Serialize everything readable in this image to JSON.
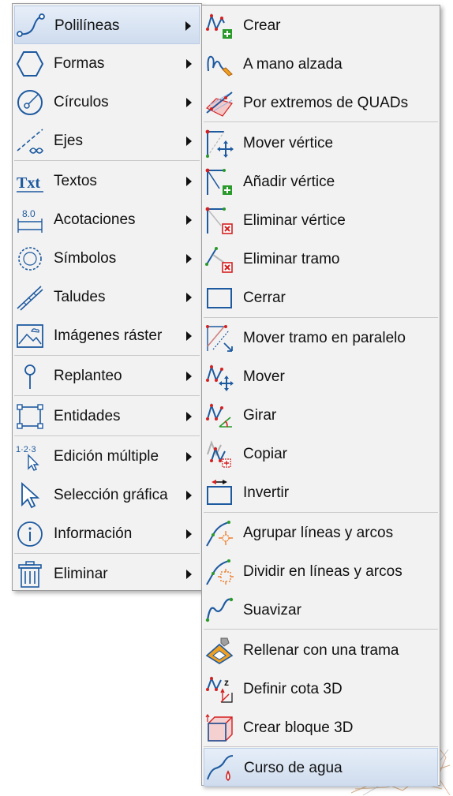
{
  "left_menu": {
    "items": [
      {
        "label": "Polilíneas",
        "icon": "polyline-icon",
        "selected": true
      },
      {
        "label": "Formas",
        "icon": "hexagon-icon"
      },
      {
        "label": "Círculos",
        "icon": "circle-icon"
      },
      {
        "label": "Ejes",
        "icon": "axis-infinity-icon"
      },
      {
        "label": "Textos",
        "icon": "text-txt-icon",
        "icon_text": "Txt"
      },
      {
        "label": "Acotaciones",
        "icon": "dimension-icon",
        "icon_text": "8.0"
      },
      {
        "label": "Símbolos",
        "icon": "symbol-icon"
      },
      {
        "label": "Taludes",
        "icon": "slope-icon"
      },
      {
        "label": "Imágenes ráster",
        "icon": "raster-image-icon"
      },
      {
        "label": "Replanteo",
        "icon": "stakeout-pin-icon"
      },
      {
        "label": "Entidades",
        "icon": "entities-icon"
      },
      {
        "label": "Edición múltiple",
        "icon": "multi-edit-icon",
        "icon_text": "1·2·3"
      },
      {
        "label": "Selección gráfica",
        "icon": "cursor-arrow-icon"
      },
      {
        "label": "Información",
        "icon": "info-icon"
      },
      {
        "label": "Eliminar",
        "icon": "trash-icon"
      }
    ]
  },
  "right_menu": {
    "items": [
      {
        "label": "Crear",
        "icon": "polyline-add-icon"
      },
      {
        "label": "A mano alzada",
        "icon": "freehand-icon"
      },
      {
        "label": "Por extremos de QUADs",
        "icon": "quad-ends-icon"
      },
      {
        "label": "Mover vértice",
        "icon": "move-vertex-icon"
      },
      {
        "label": "Añadir vértice",
        "icon": "add-vertex-icon"
      },
      {
        "label": "Eliminar vértice",
        "icon": "delete-vertex-icon"
      },
      {
        "label": "Eliminar tramo",
        "icon": "delete-segment-icon"
      },
      {
        "label": "Cerrar",
        "icon": "close-rectangle-icon"
      },
      {
        "label": "Mover tramo en paralelo",
        "icon": "parallel-move-icon"
      },
      {
        "label": "Mover",
        "icon": "move-icon"
      },
      {
        "label": "Girar",
        "icon": "rotate-icon"
      },
      {
        "label": "Copiar",
        "icon": "copy-icon"
      },
      {
        "label": "Invertir",
        "icon": "invert-icon"
      },
      {
        "label": "Agrupar líneas y arcos",
        "icon": "group-lines-icon"
      },
      {
        "label": "Dividir en líneas y arcos",
        "icon": "split-lines-icon"
      },
      {
        "label": "Suavizar",
        "icon": "smooth-icon"
      },
      {
        "label": "Rellenar con una trama",
        "icon": "fill-hatch-icon"
      },
      {
        "label": "Definir cota 3D",
        "icon": "elevation-3d-icon",
        "icon_text": "z"
      },
      {
        "label": "Crear bloque 3D",
        "icon": "block-3d-icon"
      },
      {
        "label": "Curso de agua",
        "icon": "watercourse-icon",
        "selected": true
      }
    ]
  },
  "colors": {
    "menu_bg": "#f2f2f2",
    "highlight": "#d8e4f2",
    "icon_blue": "#1e5aa0",
    "icon_red": "#d42020",
    "icon_green": "#2a9a2a"
  }
}
